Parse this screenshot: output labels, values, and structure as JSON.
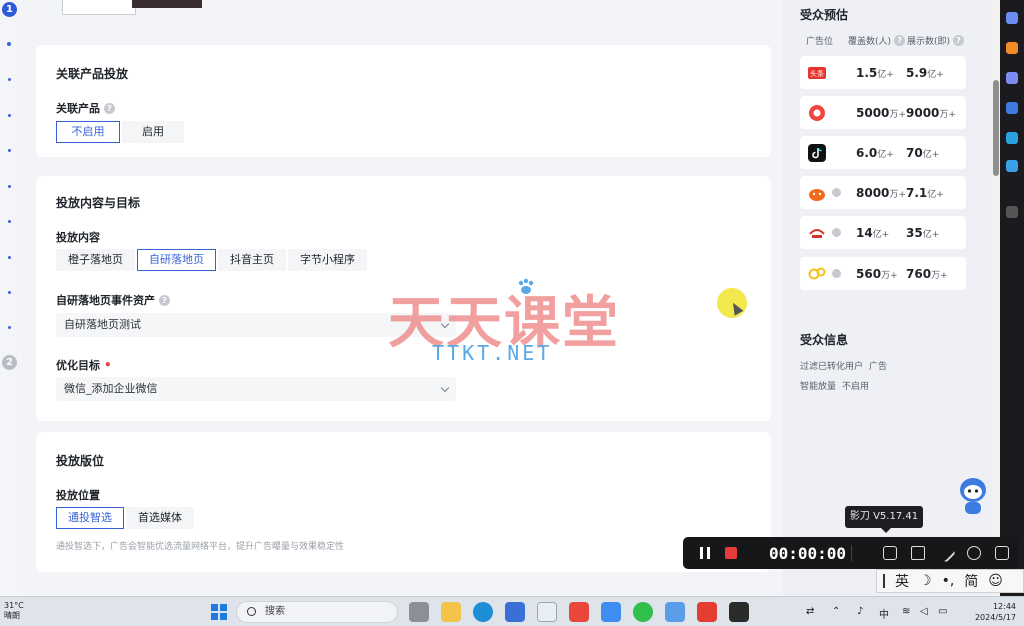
{
  "rail": {
    "step1": "1",
    "step2": "2"
  },
  "related_product": {
    "title": "关联产品投放",
    "label": "关联产品",
    "options": [
      "不启用",
      "启用"
    ],
    "selected": "不启用"
  },
  "content_goal": {
    "title": "投放内容与目标",
    "content_label": "投放内容",
    "content_options": [
      "橙子落地页",
      "自研落地页",
      "抖音主页",
      "字节小程序"
    ],
    "content_selected": "自研落地页",
    "event_asset_label": "自研落地页事件资产",
    "event_asset_value": "自研落地页测试",
    "opt_goal_label": "优化目标",
    "opt_goal_value": "微信_添加企业微信"
  },
  "placement": {
    "title": "投放版位",
    "position_label": "投放位置",
    "options": [
      "通投智选",
      "首选媒体"
    ],
    "selected": "通投智选",
    "hint": "通投智选下，广告会智能优选流量网络平台，提升广告曝量与效果稳定性"
  },
  "watermark": {
    "text": "天天课堂",
    "sub": "TTKT.NET"
  },
  "audience_forecast": {
    "title": "受众预估",
    "col_slot": "广告位",
    "col_coverage": "覆盖数(人)",
    "col_display": "展示数(即)",
    "rows": [
      {
        "media": "toutiao-icon",
        "color": "#e8342e",
        "cov": "1.5",
        "cov_unit": "亿+",
        "disp": "5.9",
        "disp_unit": "亿+"
      },
      {
        "media": "xigua-icon",
        "color": "#f0463f",
        "cov": "5000",
        "cov_unit": "万+",
        "disp": "9000",
        "disp_unit": "万+"
      },
      {
        "media": "douyin-icon",
        "color": "#111111",
        "cov": "6.0",
        "cov_unit": "亿+",
        "disp": "70",
        "disp_unit": "亿+"
      },
      {
        "media": "huoshan-icon",
        "color": "#f26a1b",
        "cov": "8000",
        "cov_unit": "万+",
        "disp": "7.1",
        "disp_unit": "亿+"
      },
      {
        "media": "pangle-icon",
        "color": "#d8352a",
        "cov": "14",
        "cov_unit": "亿+",
        "disp": "35",
        "disp_unit": "亿+"
      },
      {
        "media": "search-media-icon",
        "color": "#f4c21c",
        "cov": "560",
        "cov_unit": "万+",
        "disp": "760",
        "disp_unit": "万+"
      }
    ]
  },
  "audience_info": {
    "title": "受众信息",
    "line1_key": "过滤已转化用户",
    "line1_val": "广告",
    "line2_key": "智能放量",
    "line2_val": "不启用"
  },
  "recorder": {
    "tooltip": "影刀 V5.17.41",
    "time": "00:00:00"
  },
  "ime": {
    "lang": "英",
    "mode": "简"
  },
  "taskbar": {
    "temp": "31°C",
    "weather": "晴朗",
    "search_placeholder": "搜索",
    "input_lang": "中",
    "time": "12:44",
    "date": "2024/5/17"
  }
}
